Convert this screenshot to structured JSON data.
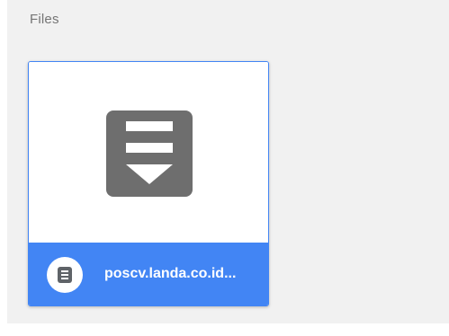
{
  "section": {
    "title": "Files"
  },
  "files": [
    {
      "name": "poscv.landa.co.id...",
      "icon": "download-file-icon",
      "badge_icon": "document-icon"
    }
  ],
  "colors": {
    "accent": "#4285f4",
    "icon_gray": "#6e6e6e",
    "panel_bg": "#f1f1f1",
    "title_text": "#757575"
  }
}
